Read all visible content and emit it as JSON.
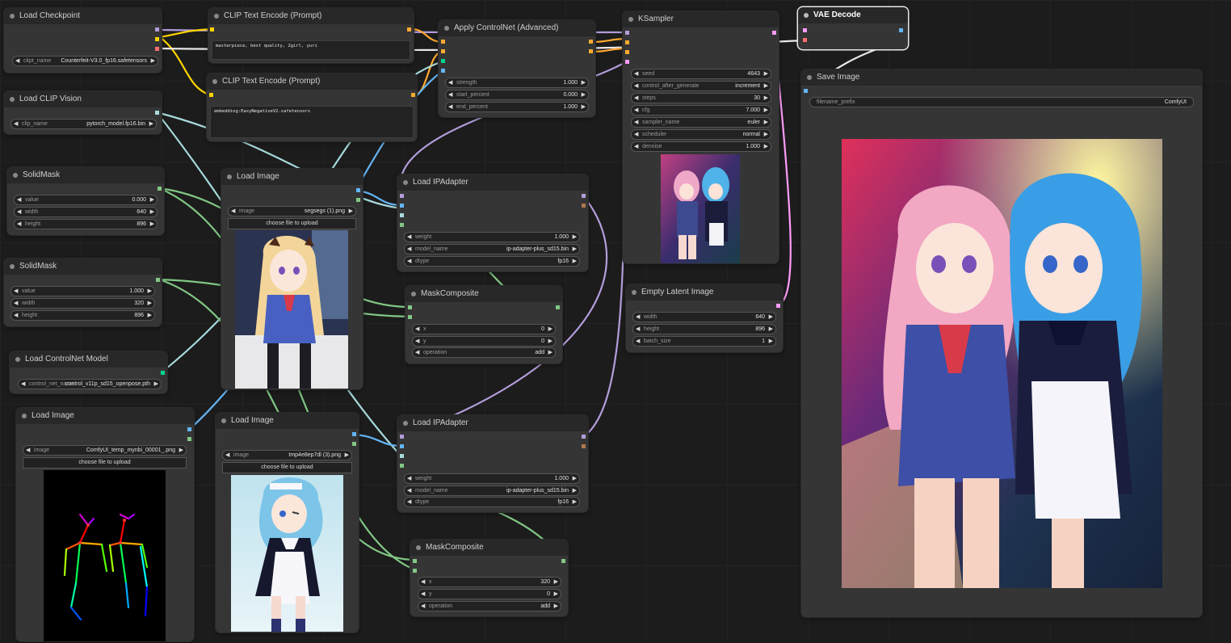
{
  "colors": {
    "model": "#b39ddb",
    "clip": "#ffd500",
    "conditioning": "#ffa931",
    "vae": "#ff6e6e",
    "image": "#64b5f6",
    "mask": "#81c784",
    "latent": "#ff9cf9",
    "clip_vision": "#a8dadc",
    "control_net": "#00d78d",
    "ipadapter": "#b17a4e"
  },
  "nodes": {
    "load_checkpoint": {
      "title": "Load Checkpoint",
      "ckpt_label": "ckpt_name",
      "ckpt_value": "Counterfeit-V3.0_fp16.safetensors"
    },
    "clip_encode_pos": {
      "title": "CLIP Text Encode (Prompt)",
      "text": "masterpiece, best quality, 2girl, yuri"
    },
    "clip_encode_neg": {
      "title": "CLIP Text Encode (Prompt)",
      "text": "embedding:EasyNegativeV2.safetensors"
    },
    "apply_controlnet": {
      "title": "Apply ControlNet (Advanced)",
      "widgets": [
        {
          "label": "strength",
          "value": "1.000"
        },
        {
          "label": "start_percent",
          "value": "0.000"
        },
        {
          "label": "end_percent",
          "value": "1.000"
        }
      ]
    },
    "ksampler": {
      "title": "KSampler",
      "widgets": [
        {
          "label": "seed",
          "value": "4643"
        },
        {
          "label": "control_after_generate",
          "value": "increment"
        },
        {
          "label": "steps",
          "value": "30"
        },
        {
          "label": "cfg",
          "value": "7.000"
        },
        {
          "label": "sampler_name",
          "value": "euler"
        },
        {
          "label": "scheduler",
          "value": "normal"
        },
        {
          "label": "denoise",
          "value": "1.000"
        }
      ]
    },
    "vae_decode": {
      "title": "VAE Decode"
    },
    "save_image": {
      "title": "Save Image",
      "prefix_label": "filename_prefix",
      "prefix_value": "ComfyUI"
    },
    "load_clip_vision": {
      "title": "Load CLIP Vision",
      "clip_label": "clip_name",
      "clip_value": "pytorch_model.fp16.bin"
    },
    "solid_mask_1": {
      "title": "SolidMask",
      "widgets": [
        {
          "label": "value",
          "value": "0.000"
        },
        {
          "label": "width",
          "value": "640"
        },
        {
          "label": "height",
          "value": "896"
        }
      ]
    },
    "solid_mask_2": {
      "title": "SolidMask",
      "widgets": [
        {
          "label": "value",
          "value": "1.000"
        },
        {
          "label": "width",
          "value": "320"
        },
        {
          "label": "height",
          "value": "896"
        }
      ]
    },
    "load_controlnet": {
      "title": "Load ControlNet Model",
      "label": "control_net_name",
      "value": "control_v11p_sd15_openpose.pth"
    },
    "load_image_1": {
      "title": "Load Image",
      "image_label": "image",
      "image_value": "segsegs (1).png",
      "upload": "choose file to upload"
    },
    "load_image_2": {
      "title": "Load Image",
      "image_label": "image",
      "image_value": "ComfyUI_temp_mynbi_00001_.png",
      "upload": "choose file to upload"
    },
    "load_image_3": {
      "title": "Load Image",
      "image_label": "image",
      "image_value": "tmp4e8ep7dl (3).png",
      "upload": "choose file to upload"
    },
    "load_ipadapter_1": {
      "title": "Load IPAdapter",
      "widgets": [
        {
          "label": "weight",
          "value": "1.000"
        },
        {
          "label": "model_name",
          "value": "ip-adapter-plus_sd15.bin"
        },
        {
          "label": "dtype",
          "value": "fp16"
        }
      ]
    },
    "load_ipadapter_2": {
      "title": "Load IPAdapter",
      "widgets": [
        {
          "label": "weight",
          "value": "1.000"
        },
        {
          "label": "model_name",
          "value": "ip-adapter-plus_sd15.bin"
        },
        {
          "label": "dtype",
          "value": "fp16"
        }
      ]
    },
    "mask_composite_1": {
      "title": "MaskComposite",
      "widgets": [
        {
          "label": "x",
          "value": "0"
        },
        {
          "label": "y",
          "value": "0"
        },
        {
          "label": "operation",
          "value": "add"
        }
      ]
    },
    "mask_composite_2": {
      "title": "MaskComposite",
      "widgets": [
        {
          "label": "x",
          "value": "320"
        },
        {
          "label": "y",
          "value": "0"
        },
        {
          "label": "operation",
          "value": "add"
        }
      ]
    },
    "empty_latent": {
      "title": "Empty Latent Image",
      "widgets": [
        {
          "label": "width",
          "value": "640"
        },
        {
          "label": "height",
          "value": "896"
        },
        {
          "label": "batch_size",
          "value": "1"
        }
      ]
    }
  }
}
